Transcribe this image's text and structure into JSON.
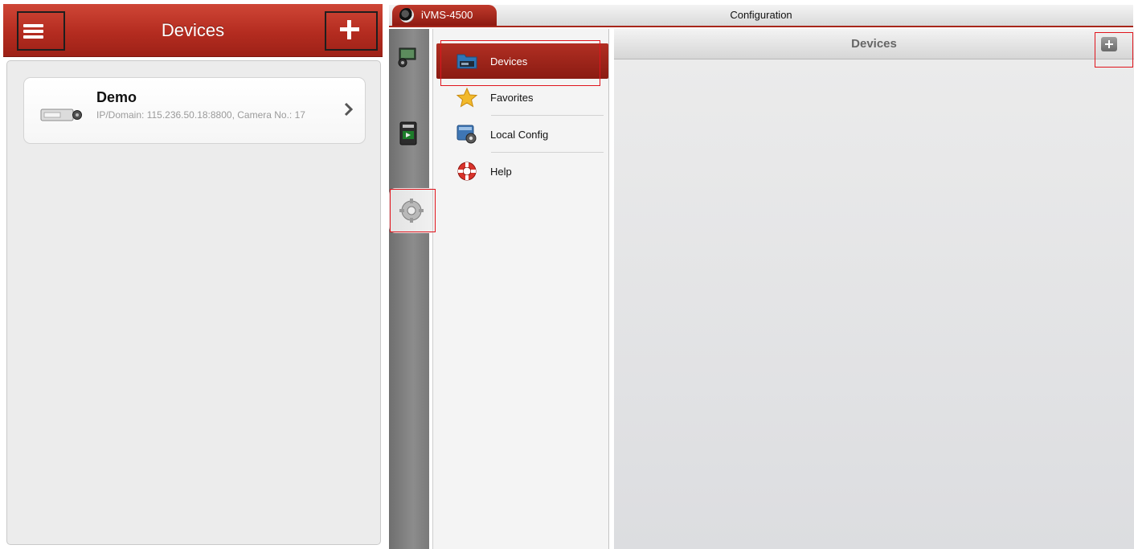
{
  "phone": {
    "title": "Devices",
    "device": {
      "name": "Demo",
      "detail": "IP/Domain: 115.236.50.18:8800, Camera No.: 17"
    }
  },
  "tablet": {
    "app_tab": "iVMS-4500",
    "window_title": "Configuration",
    "content_title": "Devices",
    "menu": [
      {
        "label": "Devices",
        "icon": "folder-icon"
      },
      {
        "label": "Favorites",
        "icon": "star-icon"
      },
      {
        "label": "Local Config",
        "icon": "config-icon"
      },
      {
        "label": "Help",
        "icon": "lifebuoy-icon"
      }
    ],
    "rail": [
      "live-view-icon",
      "playback-icon",
      "configuration-icon"
    ]
  },
  "colors": {
    "brand_red": "#b42c20",
    "highlight_box": "#e0141c"
  }
}
